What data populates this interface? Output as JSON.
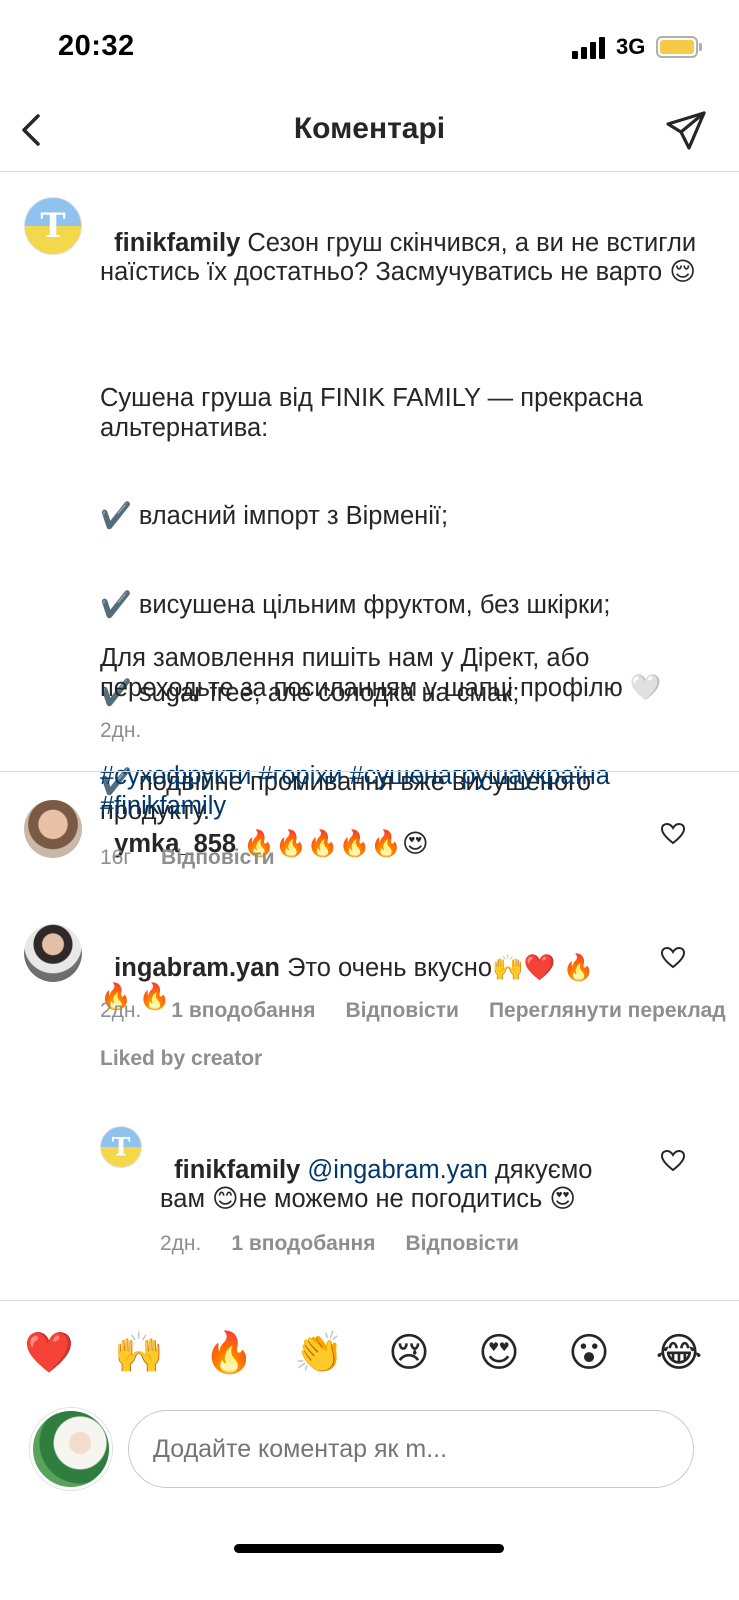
{
  "status_bar": {
    "time": "20:32",
    "network": "3G"
  },
  "nav": {
    "title": "Коментарі"
  },
  "caption": {
    "username": "finikfamily",
    "line1": " Сезон груш скінчився, а ви не вс­тигли наїстись їх достатньо? Засмучуватись не варто 😌",
    "line2": "Сушена груша від FINIK FAMILY — прекрасна альтернатива:",
    "bullet1": "✔️ власний імпорт з Вірменії;",
    "bullet2": "✔️ висушена цільним фруктом, без шкірки;",
    "bullet3": "✔️ sugar free, але солодка на смак;",
    "bullet4": "✔️ подвійне промивання вже висушеного продукту.",
    "line3": "Для замовлення пишіть нам у Дірект, або переходьте за посиланням у шапці профілю 🤍",
    "hashtags": "#сухофрукти #горіхи #сушенагрушаукраїна #finikfamily",
    "time": "2дн."
  },
  "comments": [
    {
      "username": "ymka_858",
      "text": " 🔥🔥🔥🔥🔥😍",
      "time": "16г",
      "reply_label": "Відповісти"
    },
    {
      "username": "ingabram.yan",
      "text": " Это очень вкусно🙌❤️ 🔥🔥 🔥",
      "time": "2дн.",
      "likes": "1 вподобання",
      "reply_label": "Відповісти",
      "view_translation": "Переглянути переклад",
      "liked_by": "Liked by creator"
    }
  ],
  "reply": {
    "username": "finikfamily",
    "mention": "@ingabram.yan",
    "text": " дякуємо вам 😊не можемо не погодитись 😍",
    "time": "2дн.",
    "likes": "1 вподобання",
    "reply_label": "Відповісти"
  },
  "reactions": [
    "❤️",
    "🙌",
    "🔥",
    "👏",
    "😢",
    "😍",
    "😮",
    "😂"
  ],
  "input": {
    "placeholder": "Додайте коментар як m..."
  },
  "colors": {
    "link": "#00376b",
    "meta": "#8e8e8e",
    "divider": "#dbdbdb"
  },
  "icons": {
    "back": "chevron-left-icon",
    "send": "paper-plane-icon",
    "like": "heart-outline-icon"
  }
}
